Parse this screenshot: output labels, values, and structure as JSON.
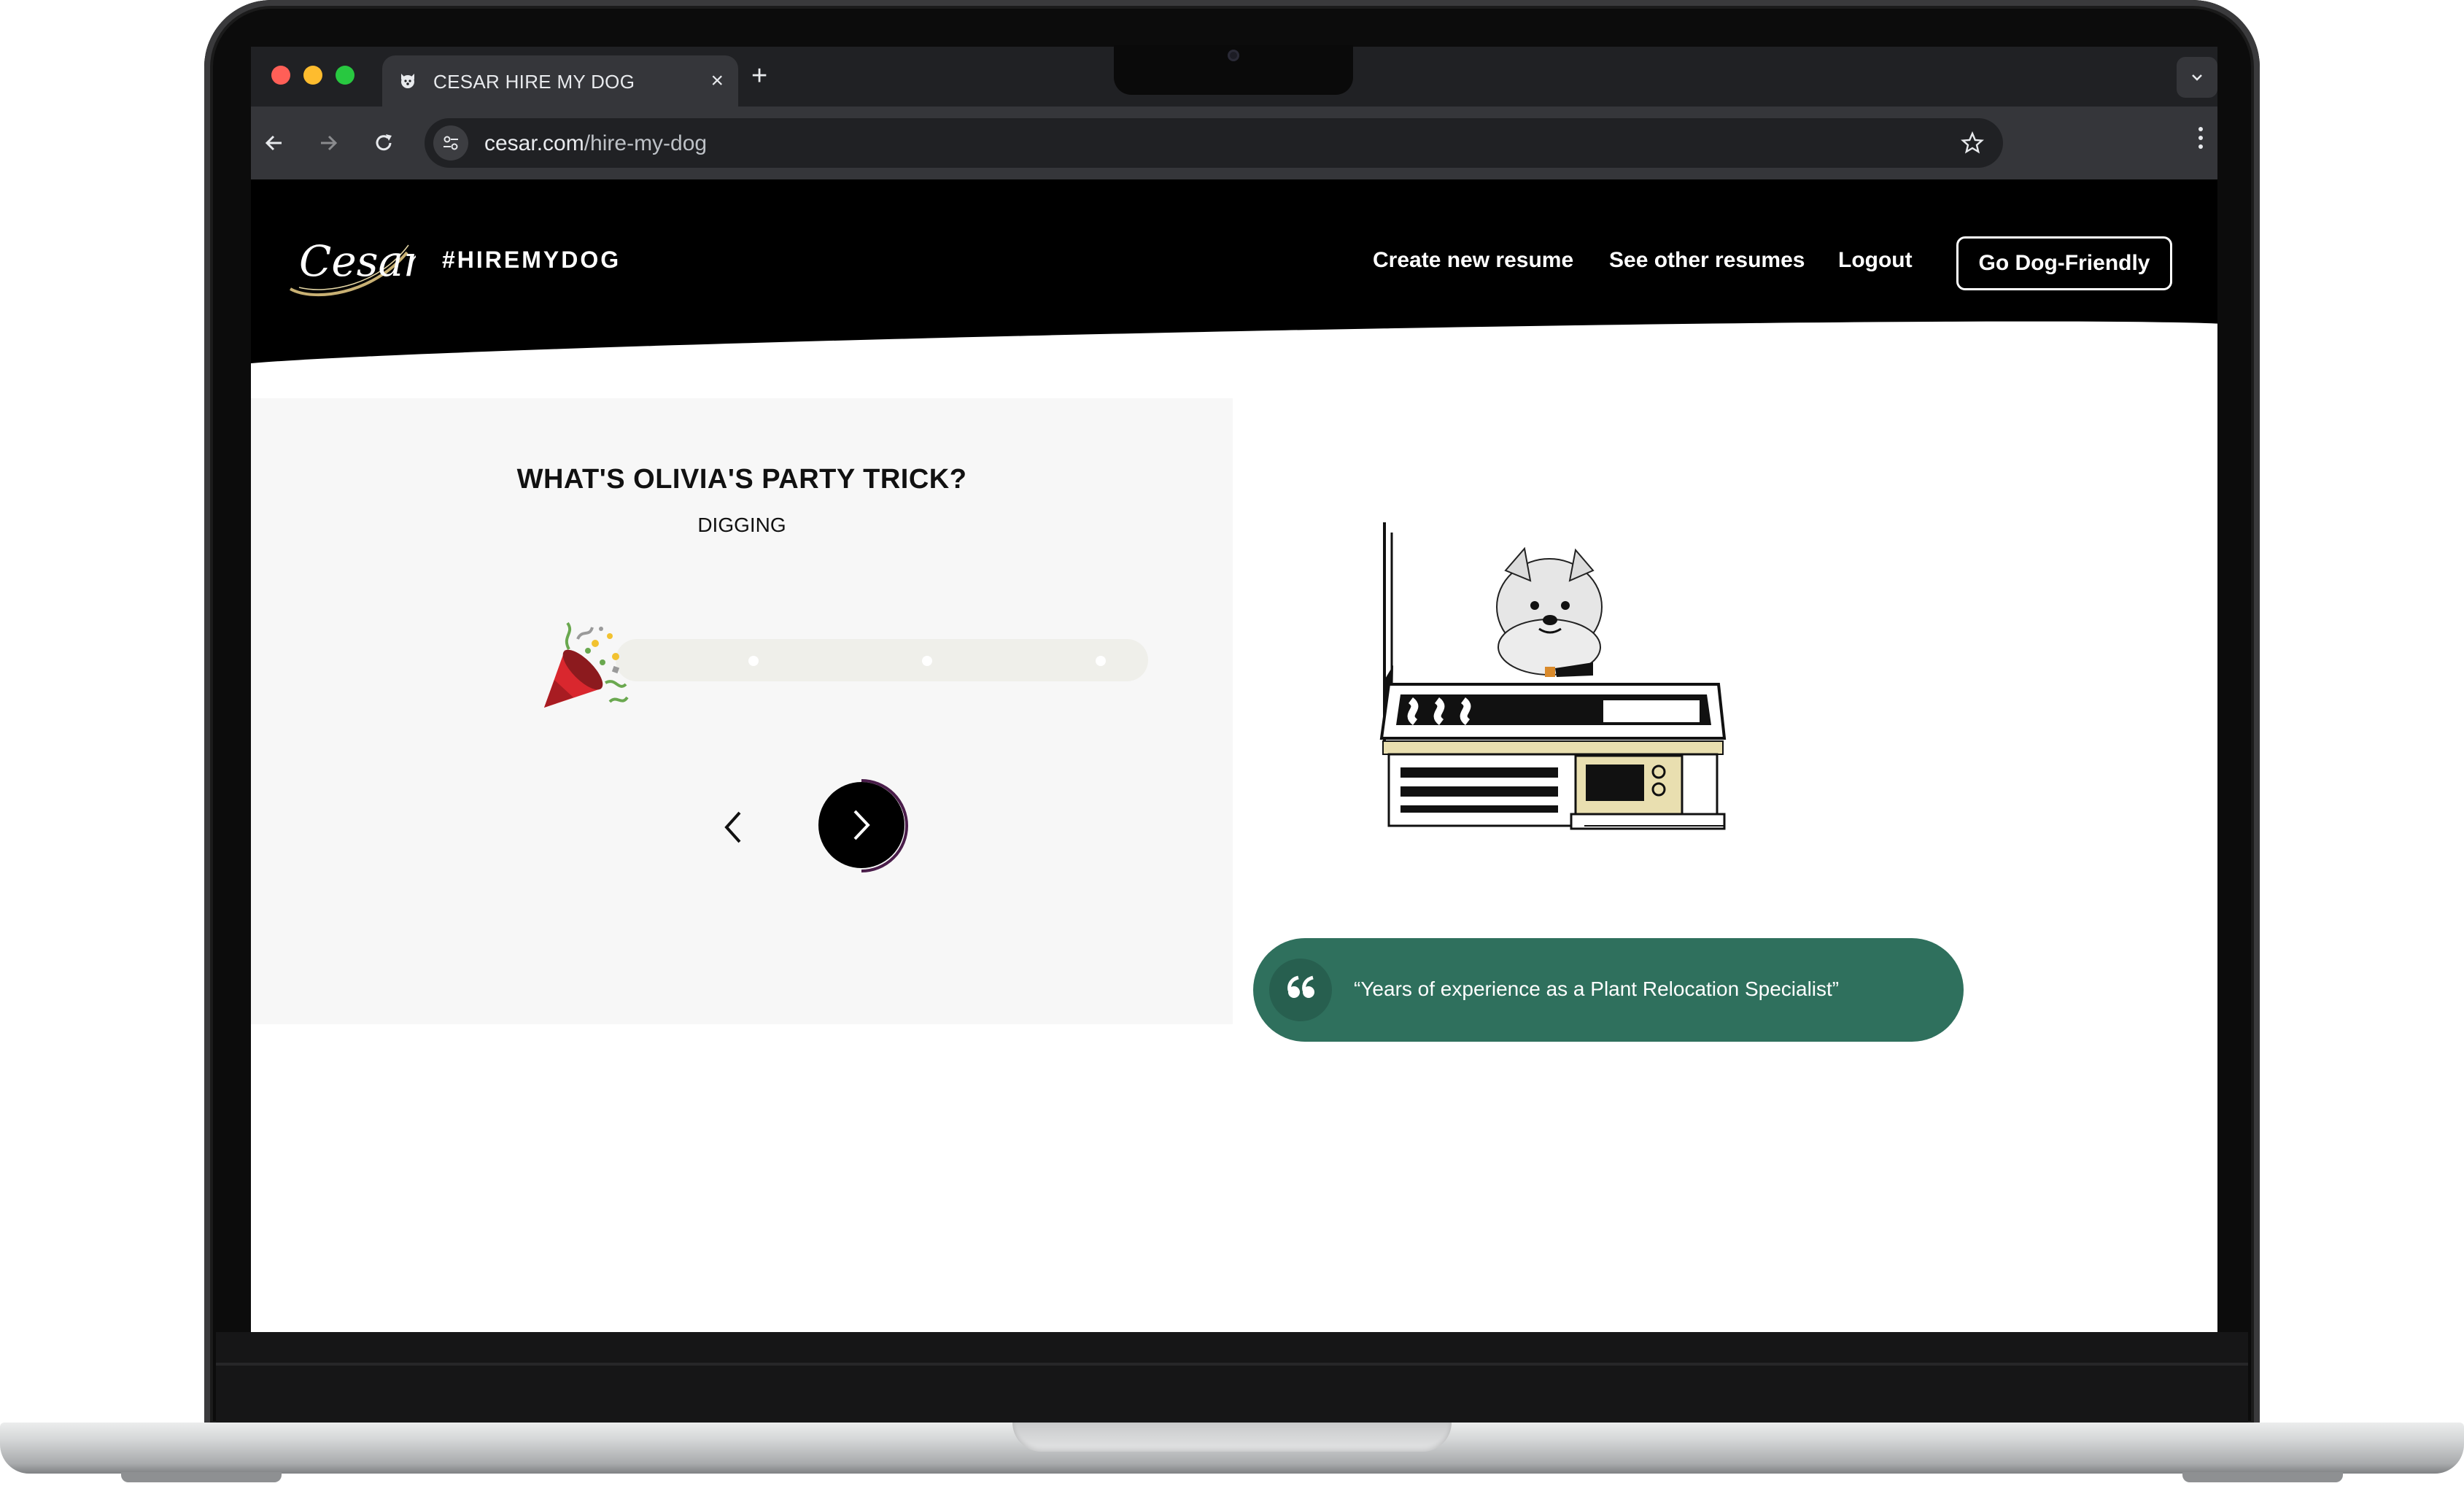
{
  "browser": {
    "tab_title": "CESAR HIRE MY DOG",
    "tab_close": "×",
    "new_tab": "+",
    "url_domain": "cesar.com",
    "url_path": "/hire-my-dog",
    "icons": [
      "back-arrow-icon",
      "forward-arrow-icon",
      "reload-icon",
      "site-info-icon",
      "star-icon",
      "kebab-menu-icon",
      "chevron-down-icon"
    ]
  },
  "header": {
    "logo_text": "Cesar",
    "hashtag": "#HIREMYDOG",
    "nav": [
      {
        "label": "Create new resume"
      },
      {
        "label": "See other resumes"
      },
      {
        "label": "Logout"
      }
    ],
    "cta_label": "Go Dog-Friendly"
  },
  "quiz": {
    "question": "WHAT'S OLIVIA'S PARTY TRICK?",
    "answer": "DIGGING",
    "progress_steps": 4,
    "progress_current": 1,
    "icon": "party-popper-icon"
  },
  "quote": {
    "icon": "quote-marks-icon",
    "text": "“Years of experience as a Plant Relocation Specialist”"
  },
  "colors": {
    "header_bg": "#000000",
    "quote_green": "#2f705d",
    "panel_bg": "#f7f7f7",
    "timer_ring": "#4a1d4a"
  }
}
